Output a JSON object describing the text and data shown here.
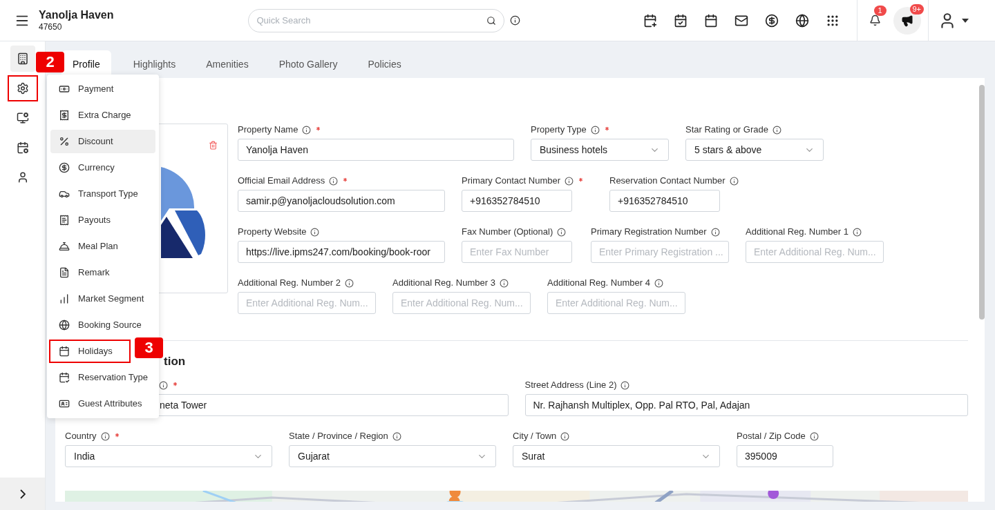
{
  "header": {
    "title": "Yanolja Haven",
    "subtitle": "47650",
    "search": {
      "placeholder": "Quick Search"
    },
    "notification_count": "1",
    "announcement_count": "9+"
  },
  "sidebar": {
    "items": [
      {
        "selected": true,
        "annotated": false
      },
      {
        "selected": false,
        "annotated": true
      },
      {
        "selected": false,
        "annotated": false
      },
      {
        "selected": false,
        "annotated": false
      },
      {
        "selected": false,
        "annotated": false
      }
    ]
  },
  "tabs": [
    {
      "label": "Profile",
      "selected": true
    },
    {
      "label": "Highlights",
      "selected": false
    },
    {
      "label": "Amenities",
      "selected": false
    },
    {
      "label": "Photo Gallery",
      "selected": false
    },
    {
      "label": "Policies",
      "selected": false
    }
  ],
  "settings_menu": {
    "items": [
      {
        "label": "Payment",
        "hovered": false,
        "annotated": false
      },
      {
        "label": "Extra Charge",
        "hovered": false,
        "annotated": false
      },
      {
        "label": "Discount",
        "hovered": true,
        "annotated": false
      },
      {
        "label": "Currency",
        "hovered": false,
        "annotated": false
      },
      {
        "label": "Transport Type",
        "hovered": false,
        "annotated": false
      },
      {
        "label": "Payouts",
        "hovered": false,
        "annotated": false
      },
      {
        "label": "Meal Plan",
        "hovered": false,
        "annotated": false
      },
      {
        "label": "Remark",
        "hovered": false,
        "annotated": false
      },
      {
        "label": "Market Segment",
        "hovered": false,
        "annotated": false
      },
      {
        "label": "Booking Source",
        "hovered": false,
        "annotated": false
      },
      {
        "label": "Holidays",
        "hovered": false,
        "annotated": true
      },
      {
        "label": "Reservation Type",
        "hovered": false,
        "annotated": false
      },
      {
        "label": "Guest Attributes",
        "hovered": false,
        "annotated": false
      }
    ]
  },
  "annotations": [
    {
      "number": "2"
    },
    {
      "number": "3"
    }
  ],
  "property_fields": [
    [
      {
        "label": "Property Name",
        "required": true,
        "kind": "input",
        "value": "Yanolja Haven"
      },
      {
        "label": "Property Type",
        "required": true,
        "kind": "select",
        "value": "Business hotels"
      },
      {
        "label": "Star Rating or Grade",
        "required": false,
        "kind": "select",
        "value": "5 stars & above"
      }
    ],
    [
      {
        "label": "Official Email Address",
        "required": true,
        "kind": "input",
        "value": "samir.p@yanoljacloudsolution.com"
      },
      {
        "label": "Primary Contact Number",
        "required": true,
        "kind": "input",
        "value": "+916352784510"
      },
      {
        "label": "Reservation Contact Number",
        "required": false,
        "kind": "input",
        "value": "+916352784510"
      }
    ],
    [
      {
        "label": "Property Website",
        "required": false,
        "kind": "input",
        "value": "https://live.ipms247.com/booking/book-roor"
      },
      {
        "label": "Fax Number (Optional)",
        "required": false,
        "kind": "input",
        "placeholder": "Enter Fax Number"
      },
      {
        "label": "Primary Registration Number",
        "required": false,
        "kind": "input",
        "placeholder": "Enter Primary Registration ..."
      },
      {
        "label": "Additional Reg. Number 1",
        "required": false,
        "kind": "input",
        "placeholder": "Enter Additional Reg. Num..."
      }
    ],
    [
      {
        "label": "Additional Reg. Number 2",
        "required": false,
        "kind": "input",
        "placeholder": "Enter Additional Reg. Num..."
      },
      {
        "label": "Additional Reg. Number 3",
        "required": false,
        "kind": "input",
        "placeholder": "Enter Additional Reg. Num..."
      },
      {
        "label": "Additional Reg. Number 4",
        "required": false,
        "kind": "input",
        "placeholder": "Enter Additional Reg. Num..."
      }
    ]
  ],
  "location_section": {
    "heading": "tion",
    "fields": [
      [
        {
          "required": true,
          "kind": "input",
          "value": "neta Tower"
        },
        {
          "label": "Street Address (Line 2)",
          "required": false,
          "kind": "input",
          "value": "Nr. Rajhansh Multiplex, Opp. Pal RTO, Pal, Adajan"
        }
      ],
      [
        {
          "label": "Country",
          "required": true,
          "kind": "select",
          "value": "India"
        },
        {
          "label": "State / Province / Region",
          "required": false,
          "kind": "select",
          "value": "Gujarat"
        },
        {
          "label": "City / Town",
          "required": false,
          "kind": "select",
          "value": "Surat"
        },
        {
          "label": "Postal / Zip Code",
          "required": false,
          "kind": "input",
          "value": "395009"
        }
      ]
    ],
    "map": {
      "kind": "picture"
    }
  }
}
